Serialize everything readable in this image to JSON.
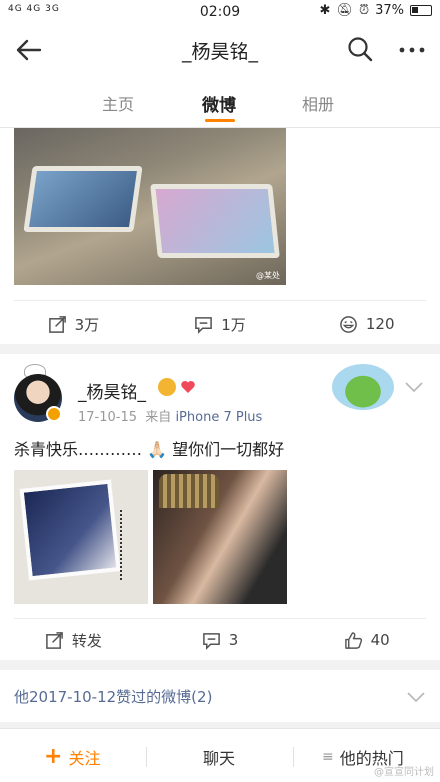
{
  "status_bar": {
    "network": "4G 4G 3G",
    "time": "02:09",
    "battery": "37%"
  },
  "nav": {
    "title": "_杨昊铭_"
  },
  "tabs": [
    {
      "label": "主页"
    },
    {
      "label": "微博"
    },
    {
      "label": "相册"
    }
  ],
  "post1": {
    "image_watermark": "@某处",
    "actions": {
      "repost": "3万",
      "comment": "1万",
      "like": "120"
    }
  },
  "post2": {
    "user_name": "_杨昊铭_",
    "date": "17-10-15",
    "source_prefix": "来自",
    "source": "iPhone 7 Plus",
    "text": "杀青快乐………… 🙏🏻 望你们一切都好",
    "actions": {
      "repost": "转发",
      "comment": "3",
      "like": "40"
    }
  },
  "liked_link": "他2017-10-12赞过的微博(2)",
  "bottom_bar": {
    "follow": "关注",
    "chat": "聊天",
    "hot": "他的热门",
    "watermark": "@宣宣同计划"
  },
  "colors": {
    "accent": "#ff8200",
    "link": "#576b95"
  }
}
